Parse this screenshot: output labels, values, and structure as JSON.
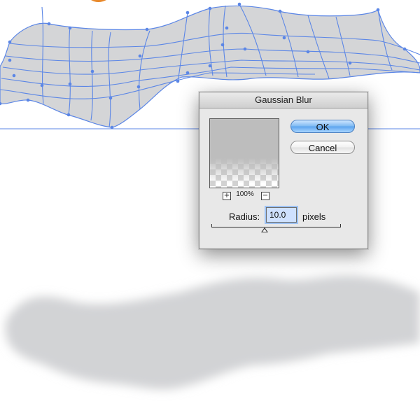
{
  "dialog": {
    "title": "Gaussian Blur",
    "ok_label": "OK",
    "cancel_label": "Cancel",
    "zoom_in_symbol": "+",
    "zoom_out_symbol": "−",
    "zoom_level": "100%",
    "radius_label": "Radius:",
    "radius_value": "10.0",
    "radius_unit": "pixels"
  },
  "colors": {
    "path_stroke": "#5b86e6",
    "shape_fill": "#d4d5d7",
    "shadow_fill": "#d2d3d5",
    "accent_orange": "#e8892b"
  }
}
